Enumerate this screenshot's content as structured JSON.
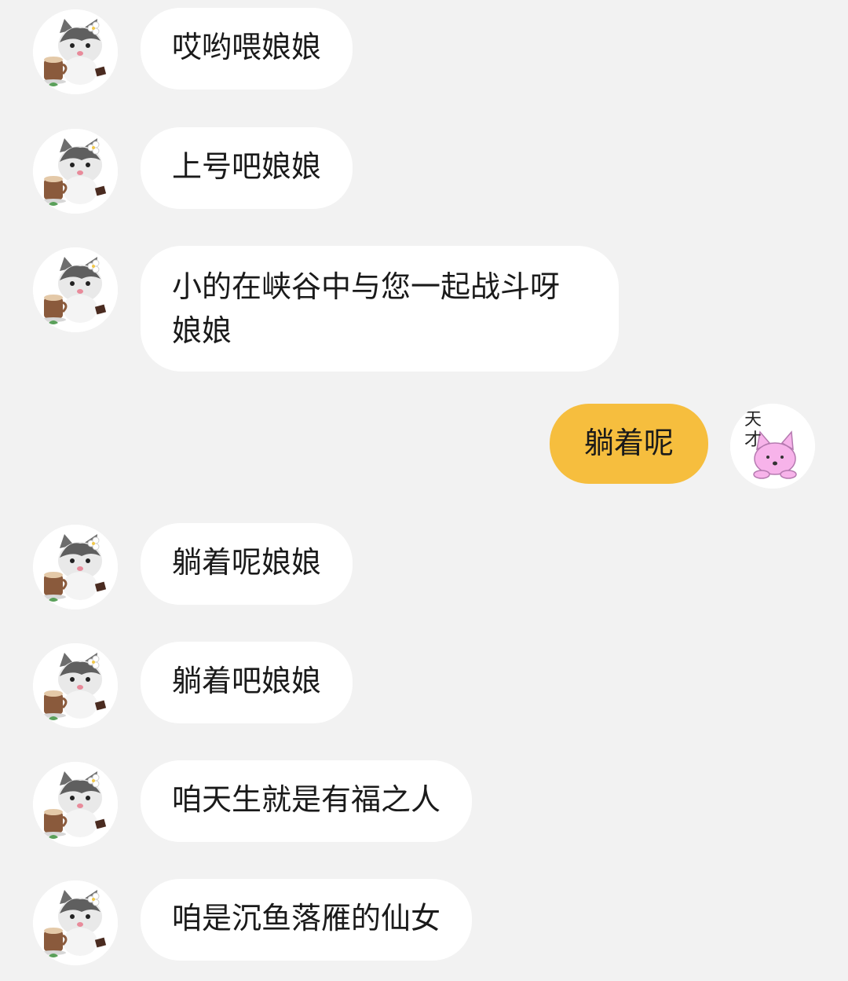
{
  "messages": [
    {
      "side": "in",
      "text": "哎哟喂娘娘"
    },
    {
      "side": "in",
      "text": "上号吧娘娘"
    },
    {
      "side": "in",
      "text": "小的在峡谷中与您一起战斗呀娘娘"
    },
    {
      "side": "out",
      "text": "躺着呢"
    },
    {
      "side": "in",
      "text": "躺着呢娘娘"
    },
    {
      "side": "in",
      "text": "躺着吧娘娘"
    },
    {
      "side": "in",
      "text": "咱天生就是有福之人"
    },
    {
      "side": "in",
      "text": "咱是沉鱼落雁的仙女"
    }
  ],
  "self_avatar_label": "天 才",
  "colors": {
    "background": "#f2f2f2",
    "incoming_bubble": "#ffffff",
    "outgoing_bubble": "#f6be3e",
    "text": "#1a1a1a"
  },
  "icons": {
    "contact_avatar": "cat-with-coffee-avatar-icon",
    "self_avatar": "pink-cat-avatar-icon"
  }
}
